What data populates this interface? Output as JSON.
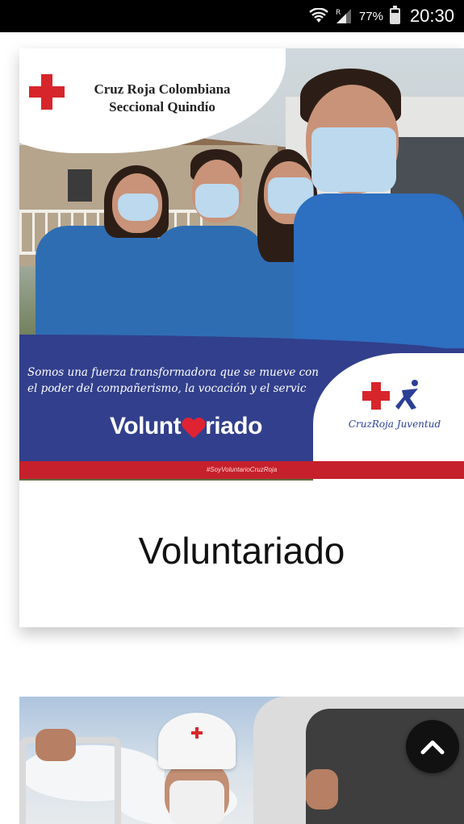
{
  "status_bar": {
    "battery_percent": "77%",
    "time": "20:30",
    "icons": [
      "wifi-icon",
      "signal-icon",
      "battery-icon"
    ]
  },
  "card": {
    "image": {
      "org_name_line1": "Cruz Roja Colombiana",
      "org_name_line2": "Seccional Quindío",
      "motto": "Somos una fuerza transformadora que se mueve con el poder del compañerismo, la vocación y el servic",
      "volunt_left": "Volunt",
      "volunt_right": "riado",
      "youth_brand": "CruzRoja Juventud",
      "hashtag": "#SoyVoluntarioCruzRoja"
    },
    "title": "Voluntariado"
  },
  "colors": {
    "red": "#d7262b",
    "navy": "#323f8c",
    "fab": "#111111"
  },
  "fab": {
    "icon": "chevron-up-icon"
  }
}
